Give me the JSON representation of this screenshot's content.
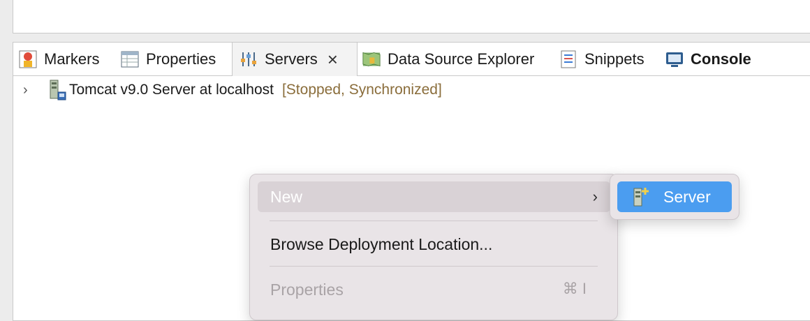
{
  "tabs": [
    {
      "label": "Markers",
      "icon": "markers-icon"
    },
    {
      "label": "Properties",
      "icon": "properties-icon"
    },
    {
      "label": "Servers",
      "icon": "servers-icon",
      "close": "×"
    },
    {
      "label": "Data Source Explorer",
      "icon": "data-source-explorer-icon"
    },
    {
      "label": "Snippets",
      "icon": "snippets-icon"
    },
    {
      "label": "Console",
      "icon": "console-icon"
    }
  ],
  "server_tree": {
    "chevron": "›",
    "name": "Tomcat v9.0 Server at localhost",
    "status": "[Stopped, Synchronized]"
  },
  "context_menu": {
    "new_label": "New",
    "new_arrow": "›",
    "browse_label": "Browse Deployment Location...",
    "properties_label": "Properties",
    "properties_shortcut": "⌘ I"
  },
  "submenu": {
    "server_label": "Server"
  },
  "colors": {
    "selection_blue": "#4b9df0",
    "status_brown": "#8a6d3b",
    "menu_bg": "#e9e4e7"
  }
}
